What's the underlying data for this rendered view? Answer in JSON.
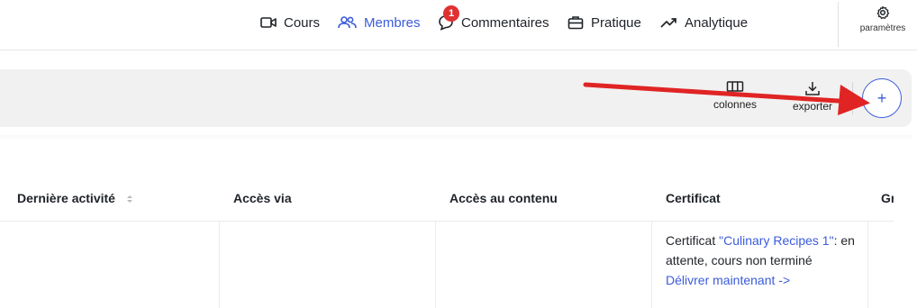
{
  "nav": {
    "items": [
      {
        "label": "Cours",
        "icon": "video-icon"
      },
      {
        "label": "Membres",
        "icon": "users-icon",
        "active": true
      },
      {
        "label": "Commentaires",
        "icon": "comment-icon",
        "badge": "1"
      },
      {
        "label": "Pratique",
        "icon": "briefcase-icon"
      },
      {
        "label": "Analytique",
        "icon": "trend-icon"
      }
    ],
    "settings_label": "paramètres"
  },
  "toolbar": {
    "columns_label": "colonnes",
    "export_label": "exporter",
    "add_label": "+"
  },
  "table": {
    "headers": [
      "Dernière activité",
      "Accès via",
      "Accès au contenu",
      "Certificat",
      "Gr"
    ],
    "row": {
      "cert_prefix": "Certificat ",
      "cert_course": "\"Culinary Recipes 1\"",
      "cert_status": ": en attente, cours non terminé ",
      "cert_action": "Délivrer maintenant ->"
    }
  },
  "colors": {
    "accent": "#3b5bdb",
    "badge": "#e03131",
    "annotation_arrow": "#e02424"
  }
}
